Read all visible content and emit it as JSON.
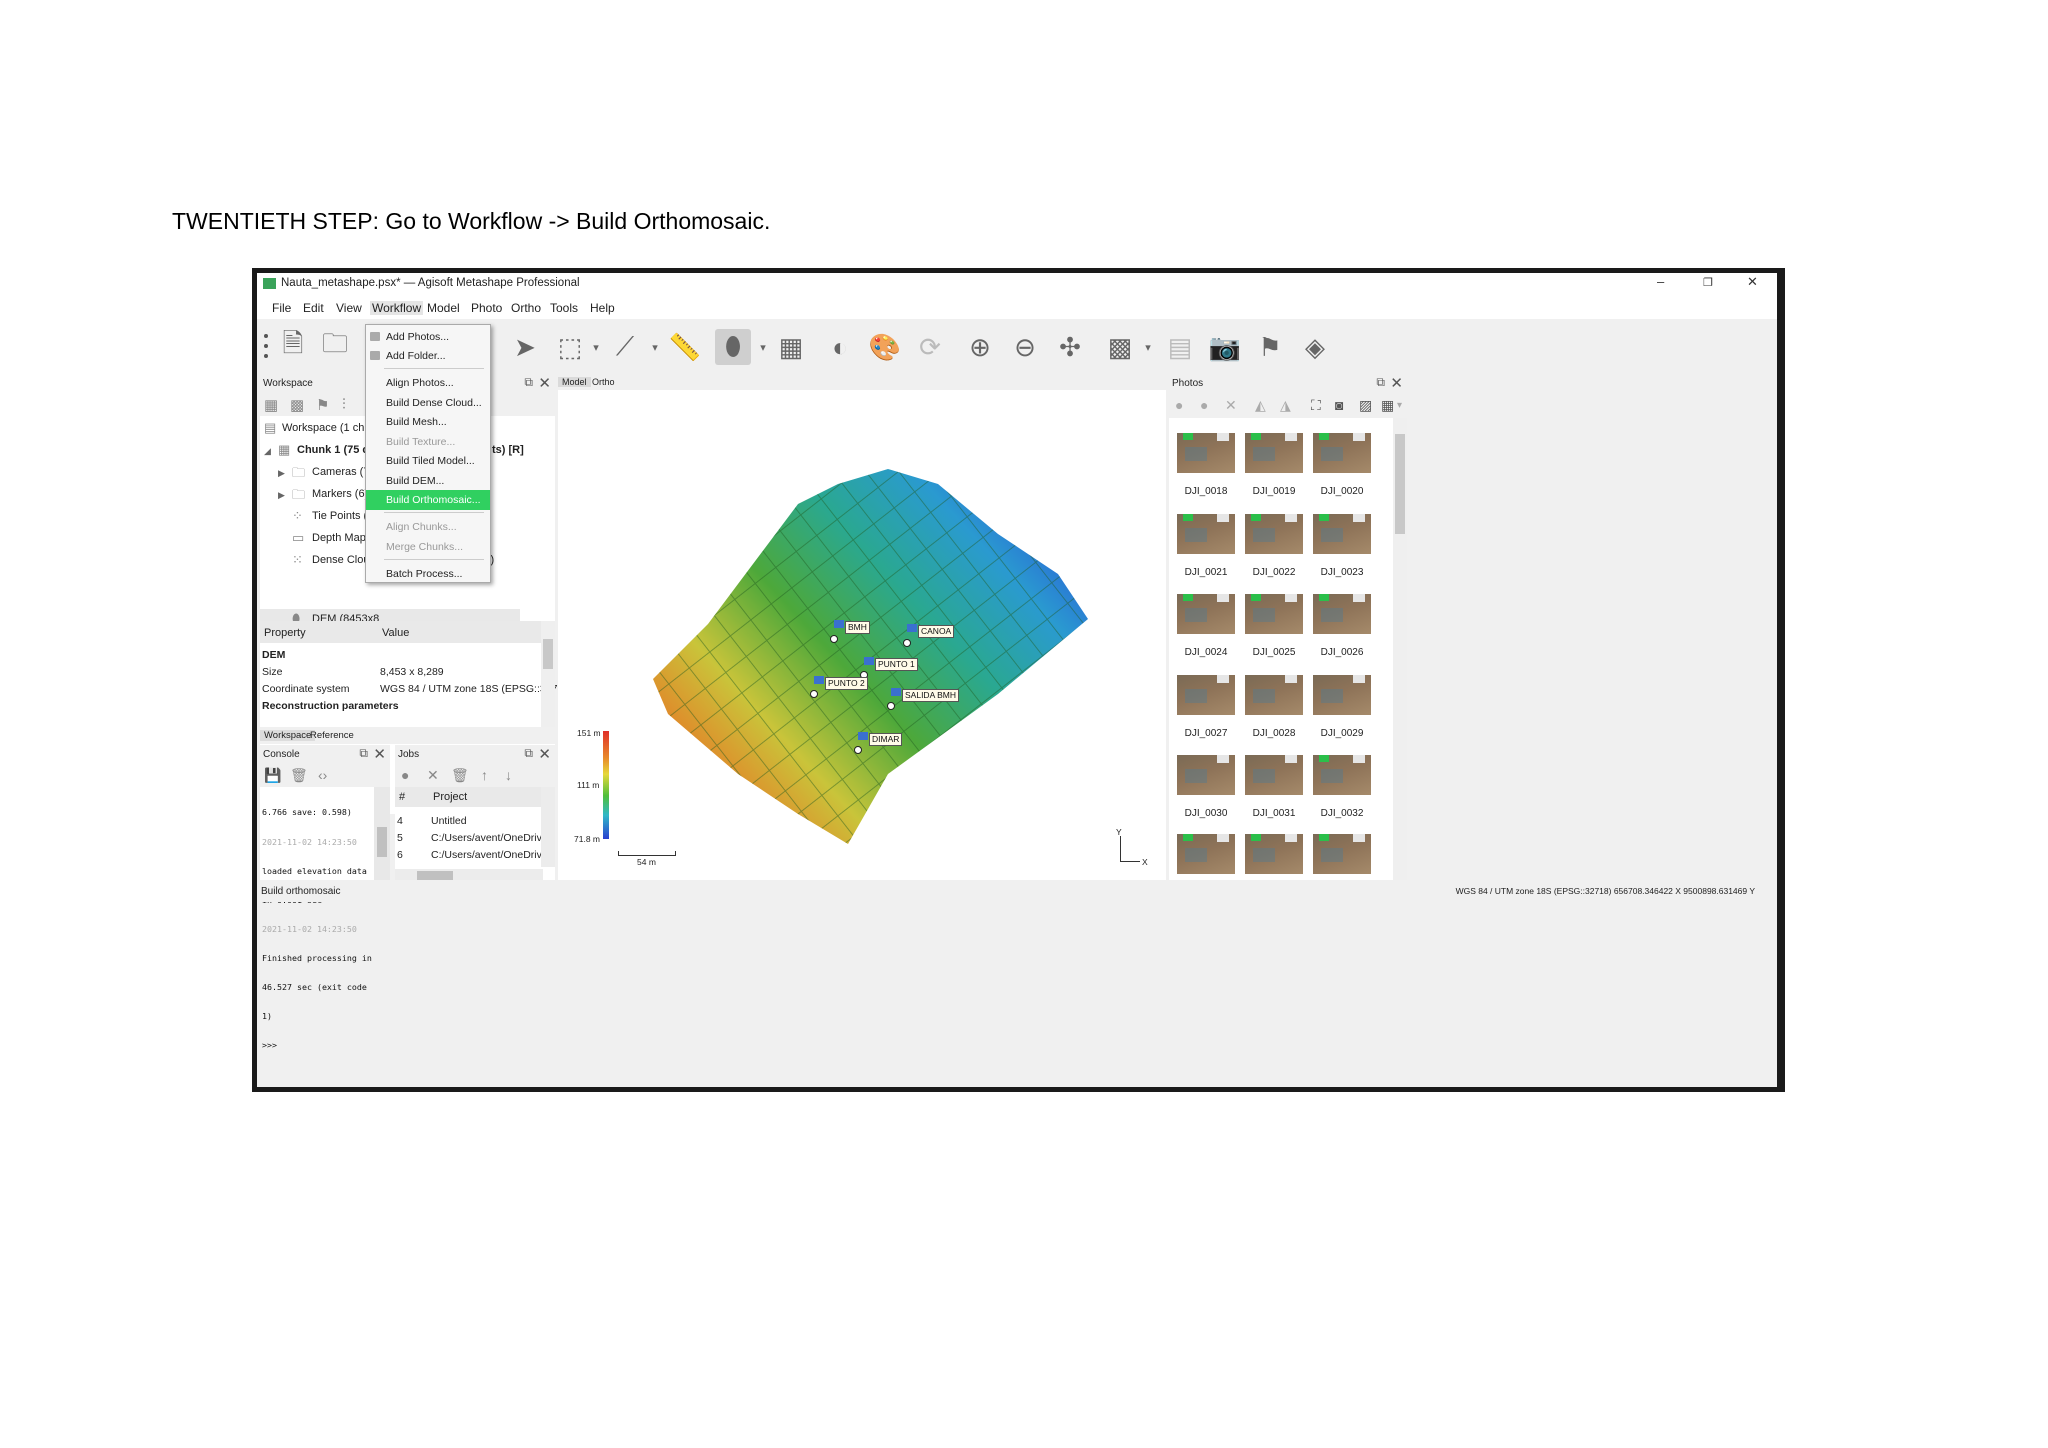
{
  "caption": "TWENTIETH STEP: Go to Workflow -> Build Orthomosaic.",
  "window": {
    "title": "Nauta_metashape.psx* — Agisoft Metashape Professional",
    "controls": [
      "–",
      "❐",
      "✕"
    ]
  },
  "menu": [
    "File",
    "Edit",
    "View",
    "Workflow",
    "Model",
    "Photo",
    "Ortho",
    "Tools",
    "Help"
  ],
  "workflow_menu": [
    {
      "label": "Add Photos...",
      "state": "normal"
    },
    {
      "label": "Add Folder...",
      "state": "normal"
    },
    {
      "label": "Align Photos...",
      "state": "normal"
    },
    {
      "label": "Build Dense Cloud...",
      "state": "normal"
    },
    {
      "label": "Build Mesh...",
      "state": "normal"
    },
    {
      "label": "Build Texture...",
      "state": "disabled"
    },
    {
      "label": "Build Tiled Model...",
      "state": "normal"
    },
    {
      "label": "Build DEM...",
      "state": "normal"
    },
    {
      "label": "Build Orthomosaic...",
      "state": "highlighted"
    },
    {
      "label": "Align Chunks...",
      "state": "disabled"
    },
    {
      "label": "Merge Chunks...",
      "state": "disabled"
    },
    {
      "label": "Batch Process...",
      "state": "normal"
    }
  ],
  "workspace": {
    "header": "Workspace",
    "tree": {
      "root": "Workspace (1 chunks,",
      "chunk": "Chunk 1 (75 cam",
      "chunk_tail": "ts) [R]",
      "cameras": "Cameras (75/",
      "markers": "Markers (6)",
      "tie_points": "Tie Points (60,",
      "depth_maps": "Depth Maps (",
      "depth_maps_tail": ")",
      "dense_cloud": "Dense Cloud (",
      "dense_cloud_tail": "y)",
      "dem": "DEM (8453x8"
    }
  },
  "properties": {
    "headers": [
      "Property",
      "Value"
    ],
    "group": "DEM",
    "rows": [
      {
        "name": "Size",
        "value": "8,453 x 8,289"
      },
      {
        "name": "Coordinate system",
        "value": "WGS 84 / UTM zone 18S (EPSG::32718)"
      }
    ],
    "group2": "Reconstruction parameters",
    "tabs": [
      "Workspace",
      "Reference"
    ]
  },
  "console": {
    "header": "Console",
    "lines": [
      {
        "text": "6.766 save: 0.598)",
        "gray": false
      },
      {
        "text": "2021-11-02 14:23:50",
        "gray": true
      },
      {
        "text": "loaded elevation data",
        "gray": false
      },
      {
        "text": "in 0.001 sec",
        "gray": false
      },
      {
        "text": "2021-11-02 14:23:50",
        "gray": true
      },
      {
        "text": "Finished processing in",
        "gray": false
      },
      {
        "text": "46.527 sec (exit code",
        "gray": false
      },
      {
        "text": "1)",
        "gray": false
      },
      {
        "text": ">>>",
        "gray": false
      }
    ]
  },
  "jobs": {
    "header": "Jobs",
    "columns": [
      "#",
      "Project"
    ],
    "rows": [
      {
        "id": "4",
        "project": "Untitled"
      },
      {
        "id": "5",
        "project": "C:/Users/avent/OneDrive/"
      },
      {
        "id": "6",
        "project": "C:/Users/avent/OneDrive/"
      }
    ]
  },
  "viewport": {
    "tabs": [
      "Model",
      "Ortho"
    ],
    "legend": {
      "max": "151 m",
      "mid": "111 m",
      "min": "71.8 m"
    },
    "scale_bar": "54 m",
    "axis_y": "Y",
    "axis_x": "X",
    "markers": [
      "BMH",
      "CANOA",
      "PUNTO 1",
      "PUNTO 2",
      "SALIDA BMH",
      "DIMAR"
    ]
  },
  "photos": {
    "header": "Photos",
    "items": [
      "DJI_0018",
      "DJI_0019",
      "DJI_0020",
      "DJI_0021",
      "DJI_0022",
      "DJI_0023",
      "DJI_0024",
      "DJI_0025",
      "DJI_0026",
      "DJI_0027",
      "DJI_0028",
      "DJI_0029",
      "DJI_0030",
      "DJI_0031",
      "DJI_0032"
    ]
  },
  "status": {
    "left": "Build orthomosaic",
    "right": "WGS 84 / UTM zone 18S (EPSG::32718)   656708.346422 X   9500898.631469 Y"
  }
}
